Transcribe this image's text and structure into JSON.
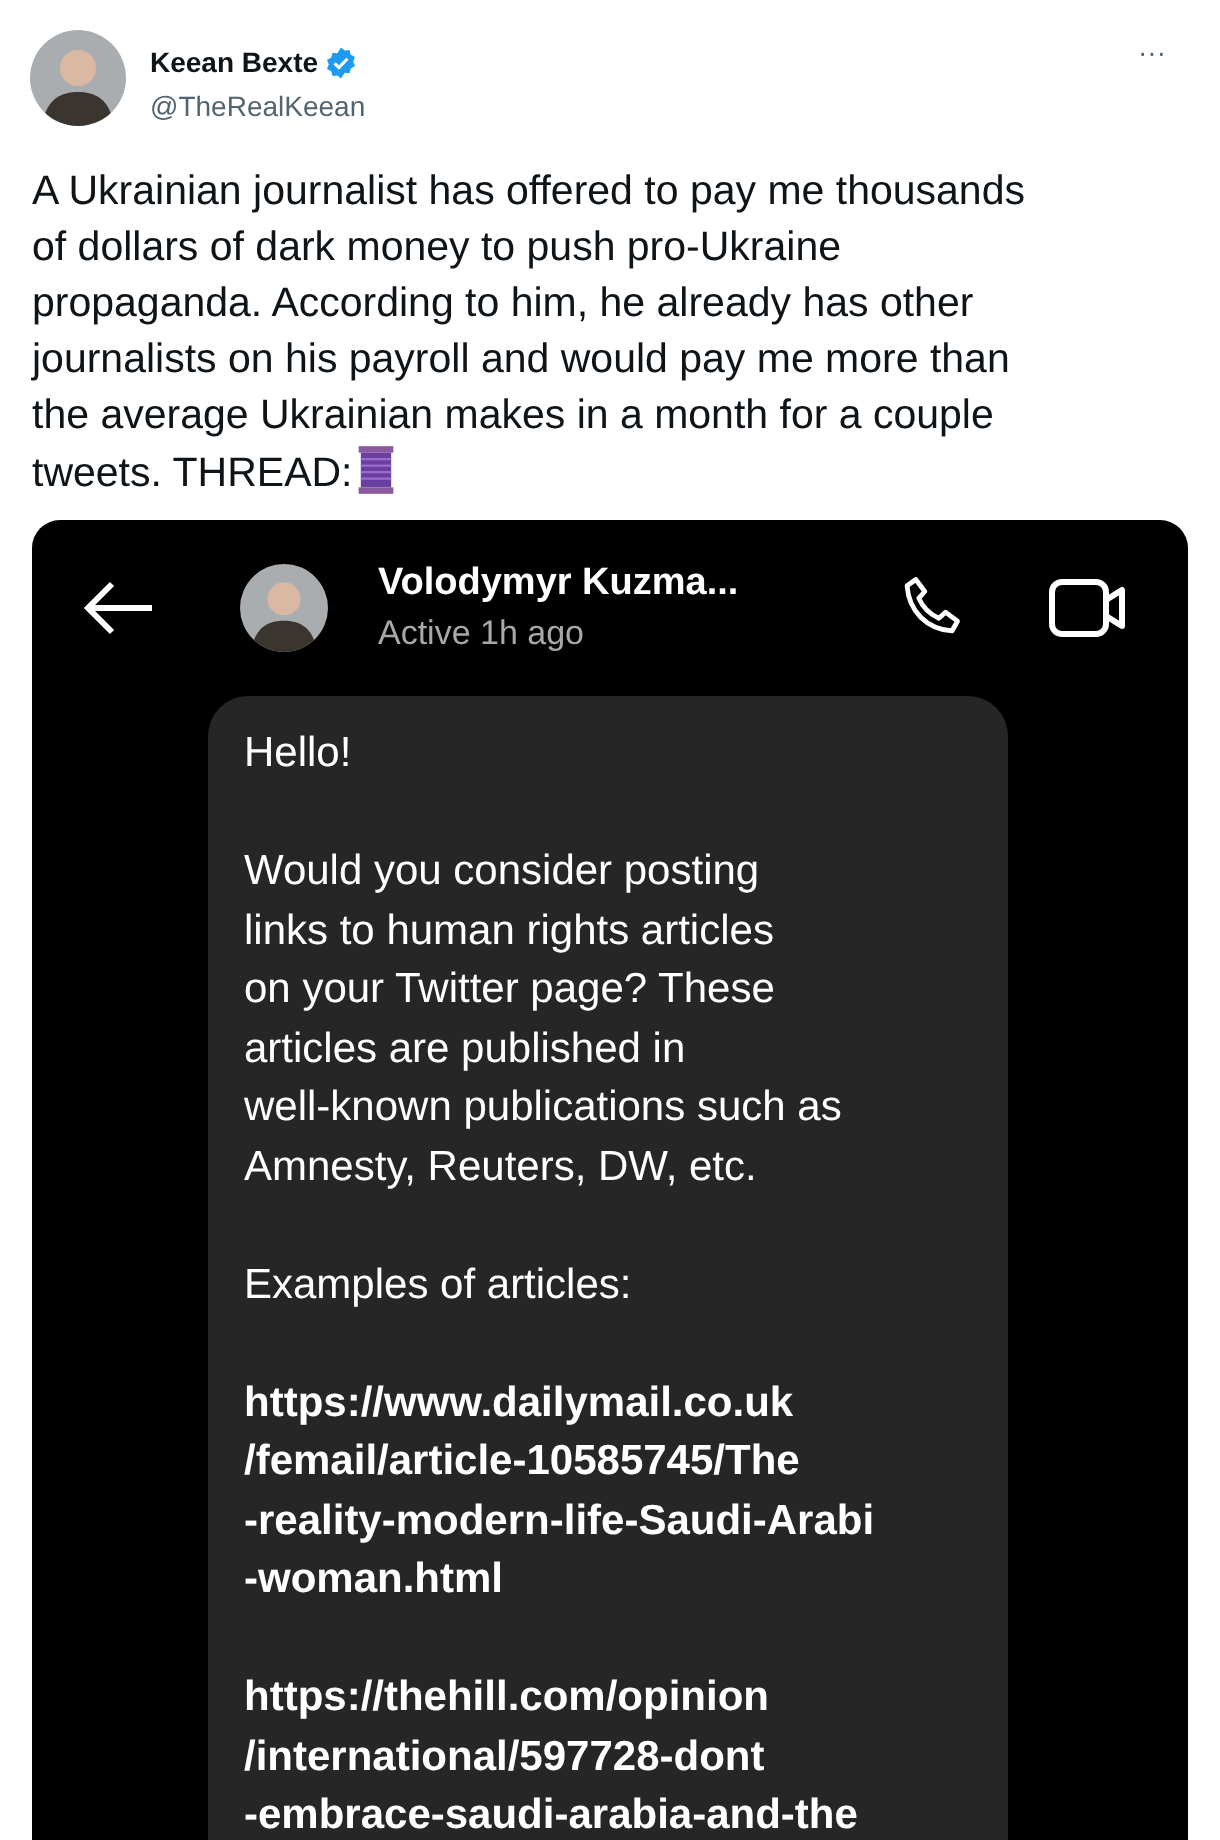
{
  "tweet": {
    "author": {
      "name": "Keean Bexte",
      "handle": "@TheRealKeean",
      "verified": true
    },
    "more": "···",
    "text_lines": [
      "A Ukrainian journalist has offered to pay me thousands",
      "of dollars of dark money to push pro-Ukraine",
      "propaganda. According to him, he already has other",
      "journalists on his payroll and would pay me more than",
      "the average Ukrainian makes in a month for a couple",
      "tweets. THREAD:"
    ]
  },
  "chat": {
    "contact": "Volodymyr Kuzma...",
    "status": "Active 1h ago",
    "message": [
      {
        "kind": "text",
        "lines": [
          "Hello!"
        ]
      },
      {
        "kind": "text",
        "lines": [
          "Would you consider posting",
          "links to human rights articles",
          "on your Twitter page? These",
          "articles are published in",
          "well-known publications such as",
          "Amnesty, Reuters, DW, etc."
        ]
      },
      {
        "kind": "text",
        "lines": [
          "Examples of articles:"
        ]
      },
      {
        "kind": "link",
        "lines": [
          "https://www.dailymail.co.uk",
          "/femail/article-10585745/The",
          "-reality-modern-life-Saudi-Arabi",
          "-woman.html"
        ]
      },
      {
        "kind": "link",
        "lines": [
          "https://thehill.com/opinion",
          "/international/597728-dont",
          "-embrace-saudi-arabia-and-the"
        ]
      }
    ]
  }
}
